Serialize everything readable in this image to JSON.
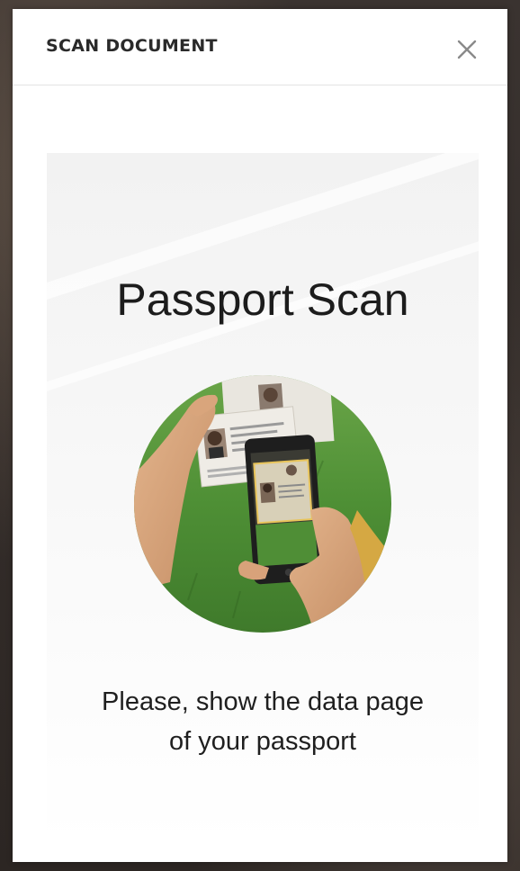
{
  "modal": {
    "title": "SCAN DOCUMENT",
    "close_icon": "close-icon"
  },
  "scan": {
    "heading": "Passport Scan",
    "illustration": "passport-scan-illustration",
    "instruction_line1": "Please, show the data page",
    "instruction_line2": "of your passport"
  },
  "colors": {
    "title_text": "#2a2a2a",
    "close_icon": "#8a8a8a",
    "grass": "#4e8f35",
    "phone": "#1e1e1e"
  }
}
